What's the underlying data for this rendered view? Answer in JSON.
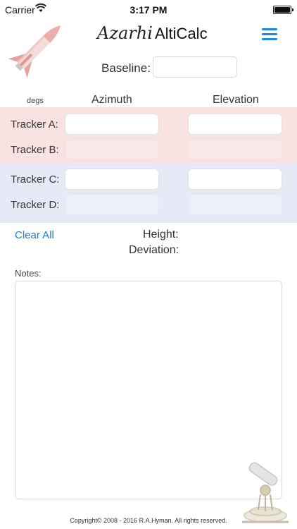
{
  "status_bar": {
    "carrier": "Carrier",
    "time": "3:17 PM"
  },
  "header": {
    "brand": "Azarhi",
    "app_name": "AltiCalc"
  },
  "baseline": {
    "label": "Baseline:",
    "value": ""
  },
  "columns": {
    "units": "degs",
    "azimuth": "Azimuth",
    "elevation": "Elevation"
  },
  "trackers": [
    {
      "label": "Tracker A:",
      "azimuth": "",
      "elevation": ""
    },
    {
      "label": "Tracker B:",
      "azimuth": "",
      "elevation": ""
    },
    {
      "label": "Tracker C:",
      "azimuth": "",
      "elevation": ""
    },
    {
      "label": "Tracker D:",
      "azimuth": "",
      "elevation": ""
    }
  ],
  "actions": {
    "clear_all": "Clear All"
  },
  "results": {
    "height_label": "Height:",
    "deviation_label": "Deviation:"
  },
  "notes": {
    "label": "Notes:",
    "value": ""
  },
  "footer": {
    "copyright": "Copyright© 2008 - 2016  R.A.Hyman.  All rights reserved."
  },
  "colors": {
    "accent": "#1e88e5",
    "band_ab": "#f9e2e2",
    "band_cd": "#e6eaf6"
  }
}
